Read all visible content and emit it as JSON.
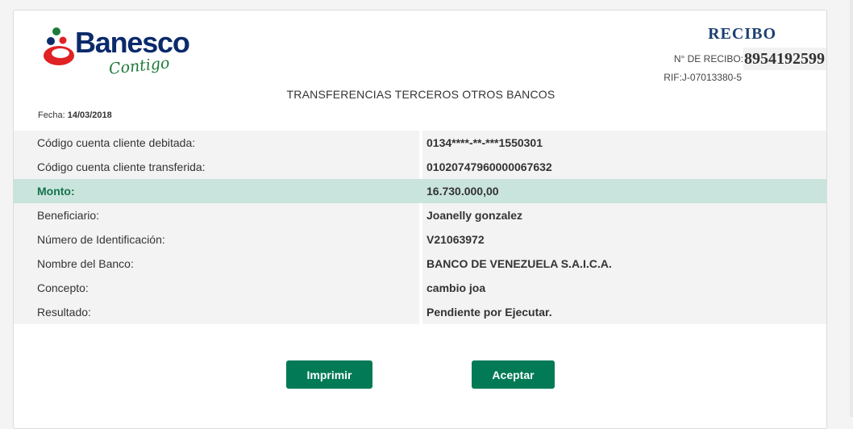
{
  "brand": {
    "name": "Banesco",
    "tagline": "Contigo",
    "colors": {
      "navy": "#0a2a6b",
      "red": "#e02224",
      "green": "#1e7a3a"
    }
  },
  "receipt": {
    "title": "RECIBO",
    "number_label": "N° DE RECIBO:",
    "number": "8954192599",
    "rif": "RIF:J-07013380-5"
  },
  "page_title": "TRANSFERENCIAS TERCEROS OTROS BANCOS",
  "date": {
    "label": "Fecha:",
    "value": "14/03/2018"
  },
  "details": [
    {
      "label": "Código cuenta cliente debitada:",
      "value": "0134****-**-***1550301",
      "highlight": false
    },
    {
      "label": "Código cuenta cliente transferida:",
      "value": "01020747960000067632",
      "highlight": false
    },
    {
      "label": "Monto:",
      "value": "16.730.000,00",
      "highlight": true
    },
    {
      "label": "Beneficiario:",
      "value": "Joanelly gonzalez",
      "highlight": false
    },
    {
      "label": "Número de Identificación:",
      "value": "V21063972",
      "highlight": false
    },
    {
      "label": "Nombre del Banco:",
      "value": "BANCO DE VENEZUELA S.A.I.C.A.",
      "highlight": false
    },
    {
      "label": "Concepto:",
      "value": "cambio joa",
      "highlight": false
    },
    {
      "label": "Resultado:",
      "value": "Pendiente por Ejecutar.",
      "highlight": false
    }
  ],
  "buttons": {
    "print": "Imprimir",
    "accept": "Aceptar"
  },
  "colors": {
    "button_bg": "#017a55",
    "highlight_row_bg": "#c9e4dd",
    "highlight_label": "#14734a",
    "row_bg": "#f3f3f3"
  }
}
